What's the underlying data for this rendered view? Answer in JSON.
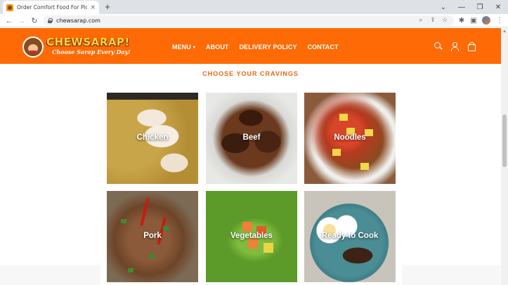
{
  "browser": {
    "tab_title": "Order Comfort Food For Pick Up",
    "tab_close": "×",
    "new_tab": "+",
    "url": "chewsarap.com",
    "window_controls": [
      "⌄",
      "—",
      "❐",
      "✕"
    ]
  },
  "site": {
    "logo_word": "CHEWSARAP!",
    "logo_tagline": "Choose Sarap Every Day!",
    "nav": [
      {
        "label": "MENU",
        "has_dropdown": true
      },
      {
        "label": "ABOUT"
      },
      {
        "label": "DELIVERY POLICY"
      },
      {
        "label": "CONTACT"
      }
    ],
    "header_icons": [
      "search-icon",
      "account-icon",
      "cart-icon"
    ],
    "accent_color": "#fe6a05"
  },
  "section": {
    "title": "CHOOSE YOUR CRAVINGS",
    "categories": [
      {
        "label": "Chicken"
      },
      {
        "label": "Beef"
      },
      {
        "label": "Noodles"
      },
      {
        "label": "Pork"
      },
      {
        "label": "Vegetables"
      },
      {
        "label": "Ready to Cook"
      }
    ]
  }
}
